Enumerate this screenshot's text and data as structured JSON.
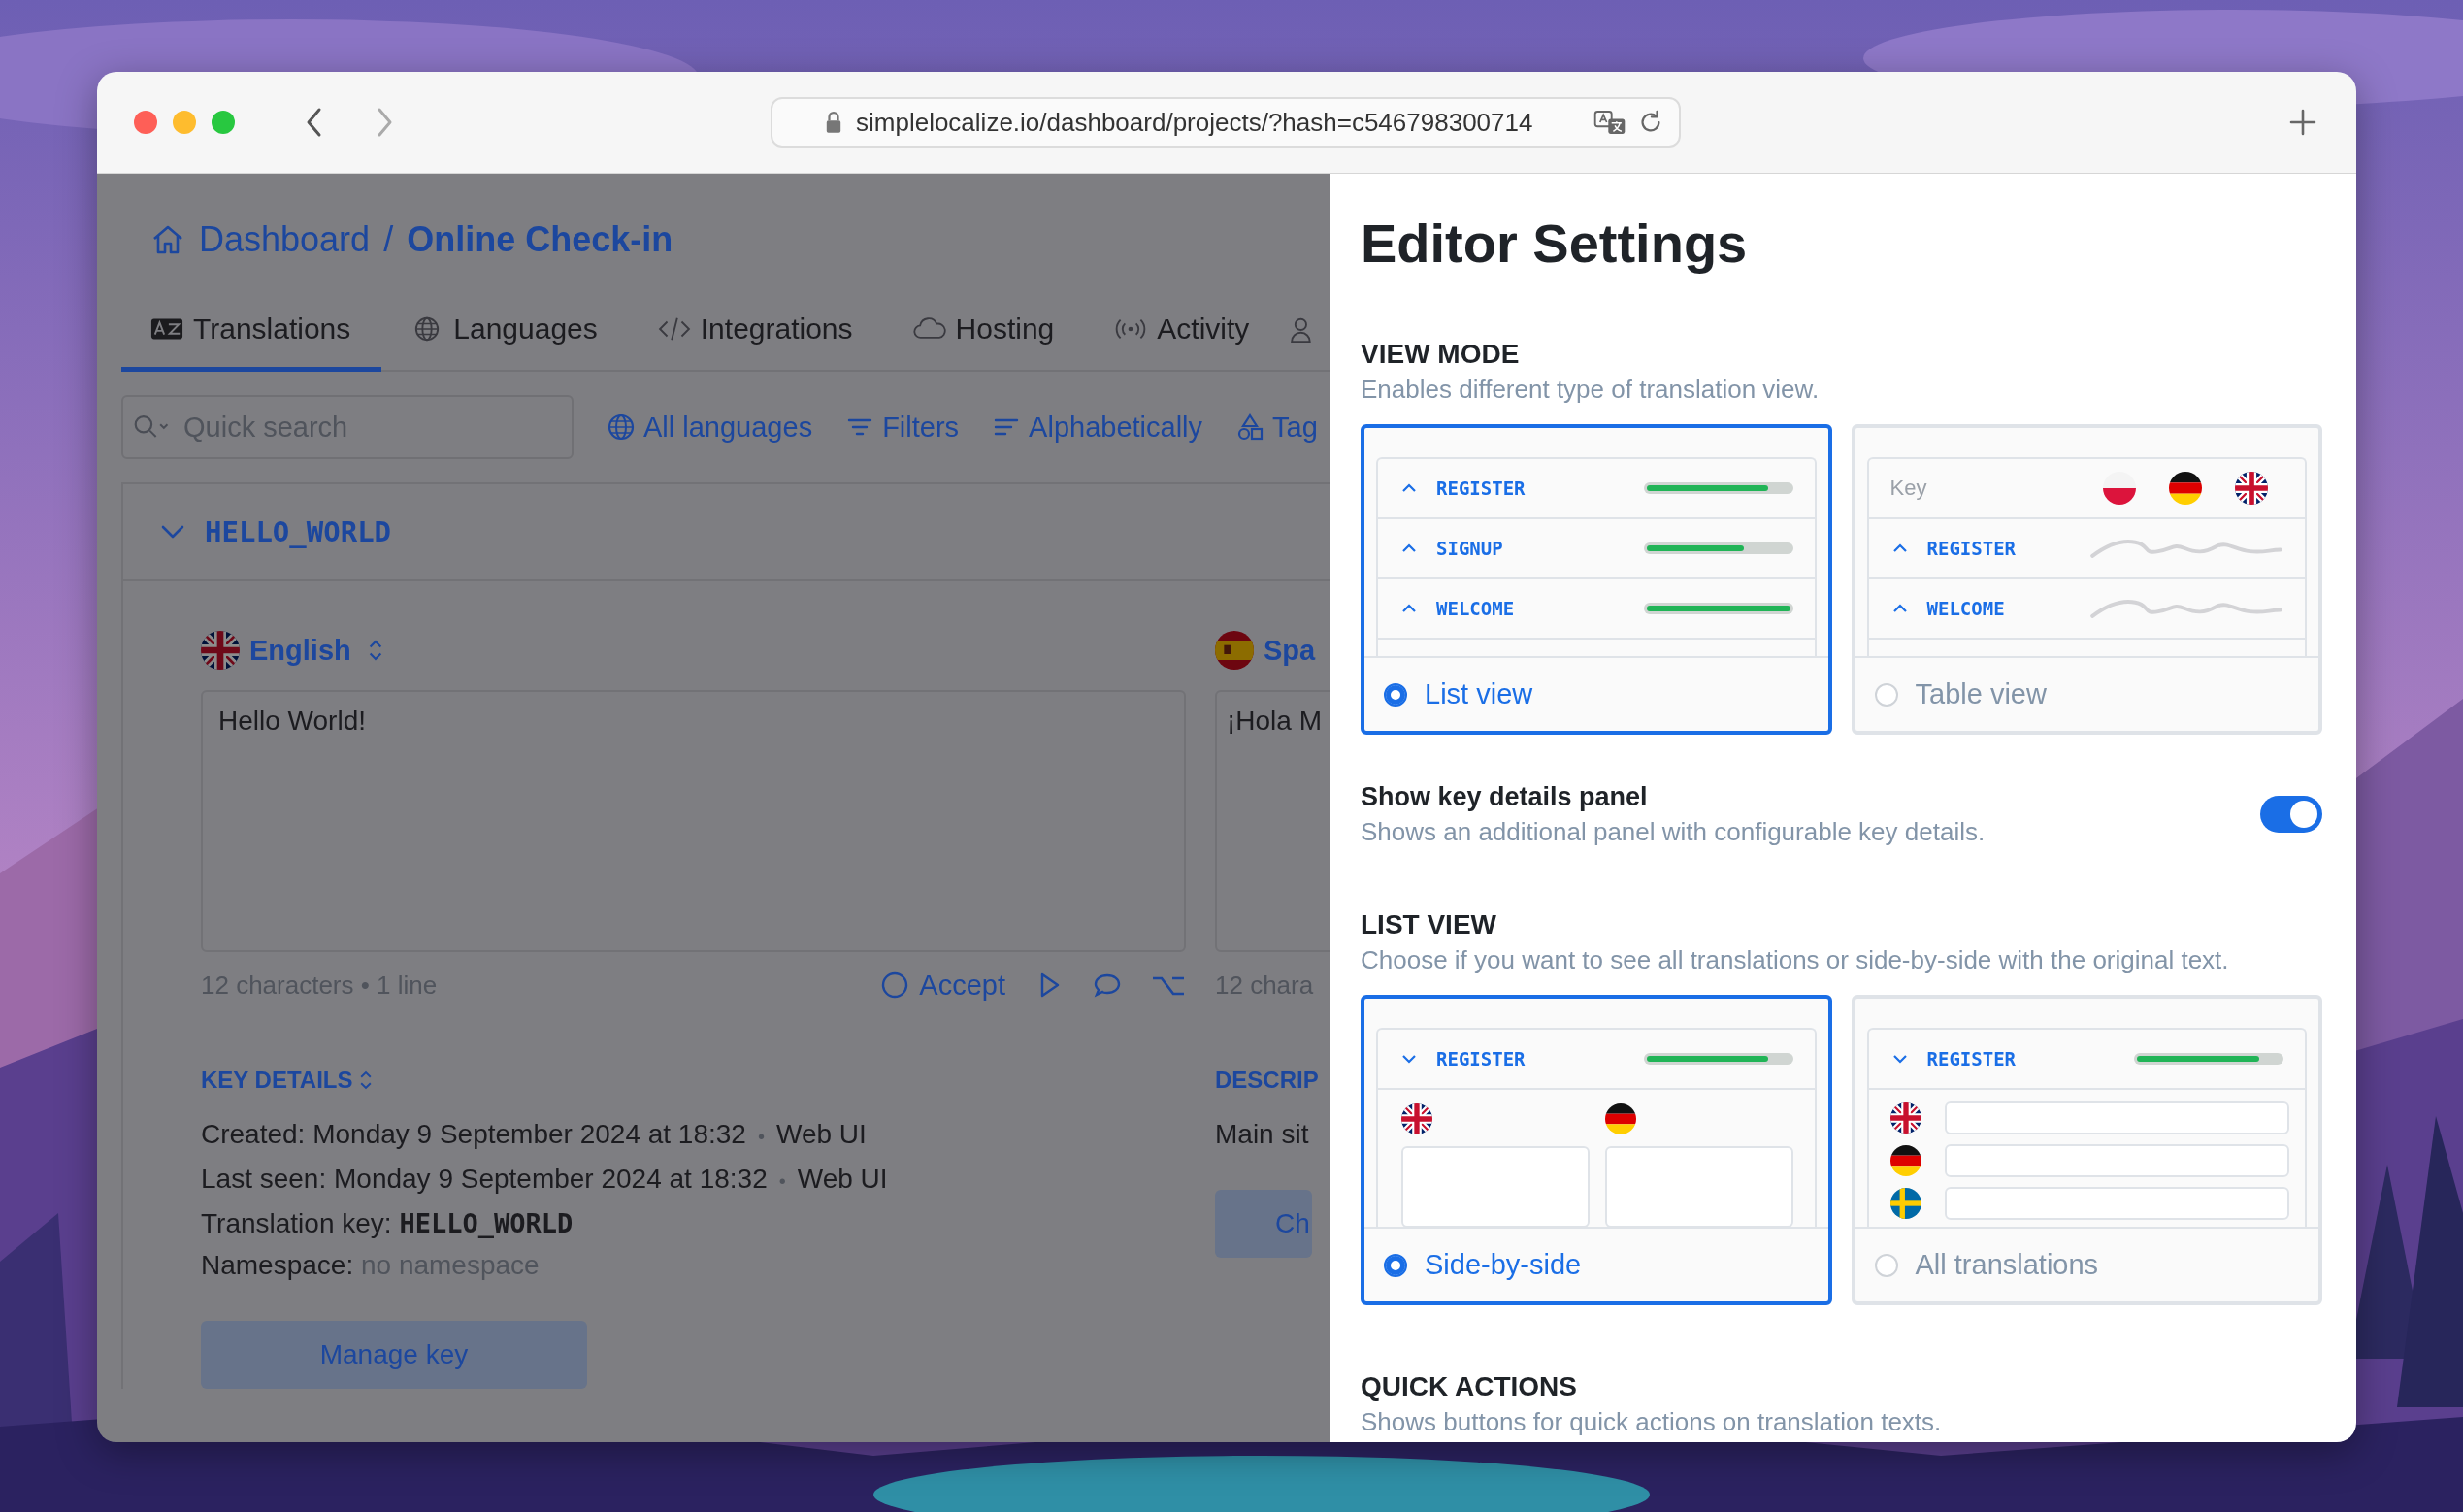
{
  "browser": {
    "url": "simplelocalize.io/dashboard/projects/?hash=c546798300714"
  },
  "breadcrumb": {
    "parent": "Dashboard",
    "separator": "/",
    "current": "Online Check-in"
  },
  "tabs": [
    {
      "label": "Translations",
      "selected": true
    },
    {
      "label": "Languages",
      "selected": false
    },
    {
      "label": "Integrations",
      "selected": false
    },
    {
      "label": "Hosting",
      "selected": false
    },
    {
      "label": "Activity",
      "selected": false
    }
  ],
  "search": {
    "placeholder": "Quick search"
  },
  "toolbar": [
    {
      "label": "All languages"
    },
    {
      "label": "Filters"
    },
    {
      "label": "Alphabetically"
    },
    {
      "label": "Tag"
    }
  ],
  "key": {
    "name": "HELLO_WORLD",
    "expanded": true
  },
  "translations": [
    {
      "language": "English",
      "text": "Hello World!",
      "stats": "12 characters • 1 line",
      "accept": "Accept"
    },
    {
      "language": "Spa",
      "text": "¡Hola M",
      "stats": "12 chara"
    }
  ],
  "key_details": {
    "heading": "KEY DETAILS",
    "lines": [
      {
        "kind": "date",
        "label": "Created:",
        "value": "Monday 9 September 2024 at 18:32",
        "separator": "•",
        "source": "Web UI"
      },
      {
        "kind": "date",
        "label": "Last seen:",
        "value": "Monday 9 September 2024 at 18:32",
        "separator": "•",
        "source": "Web UI"
      },
      {
        "kind": "code",
        "label": "Translation key:",
        "value": "HELLO_WORLD"
      },
      {
        "kind": "muted",
        "label": "Namespace:",
        "value": "no namespace"
      }
    ]
  },
  "description": {
    "heading": "DESCRIP",
    "text": "Main sit"
  },
  "buttons": [
    "Manage key",
    "Ch"
  ],
  "settings": {
    "title": "Editor Settings",
    "view_mode": {
      "heading": "VIEW MODE",
      "description": "Enables different type of translation view.",
      "options": [
        {
          "kind": "list",
          "label": "List view",
          "selected": true,
          "rows": [
            {
              "key": "REGISTER",
              "level": 0.85
            },
            {
              "key": "SIGNUP",
              "level": 0.68
            },
            {
              "key": "WELCOME",
              "level": 1
            }
          ]
        },
        {
          "kind": "table",
          "label": "Table view",
          "selected": false,
          "header": "Key",
          "rows": [
            {
              "key": "REGISTER"
            },
            {
              "key": "WELCOME"
            }
          ]
        }
      ]
    },
    "key_details_panel": {
      "label": "Show key details panel",
      "description": "Shows an additional panel with configurable key details.",
      "on": true
    },
    "list_view": {
      "heading": "LIST VIEW",
      "description": "Choose if you want to see all translations or side-by-side with the original text.",
      "options": [
        {
          "kind": "side",
          "label": "Side-by-side",
          "selected": true,
          "key": "REGISTER",
          "level": 0.85
        },
        {
          "kind": "all",
          "label": "All translations",
          "selected": false,
          "key": "REGISTER",
          "level": 0.85
        }
      ]
    },
    "quick_actions": {
      "heading": "QUICK ACTIONS",
      "description": "Shows buttons for quick actions on translation texts."
    }
  }
}
